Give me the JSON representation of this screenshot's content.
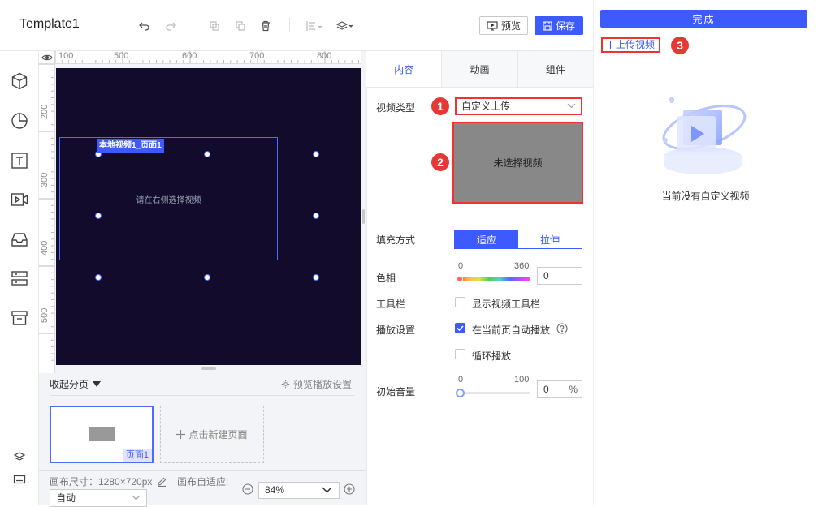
{
  "header": {
    "title": "Template1",
    "preview_label": "预览",
    "save_label": "保存"
  },
  "canvas": {
    "ruler_top": [
      "100",
      "500",
      "600",
      "700",
      "800"
    ],
    "ruler_left": [
      "200",
      "300",
      "400",
      "500"
    ],
    "video_tag": "本地视频1_页面1",
    "video_hint": "请在右侧选择视频"
  },
  "pages": {
    "collapse_label": "收起分页",
    "preview_settings_label": "预览播放设置",
    "page_label": "页面1",
    "new_page_label": "点击新建页面",
    "canvas_size_label": "画布尺寸：1280×720px",
    "canvas_fit_label": "画布自适应:",
    "fit_value": "自动",
    "zoom_value": "84%"
  },
  "panel": {
    "tabs": [
      "内容",
      "动画",
      "组件"
    ],
    "video_type_label": "视频类型",
    "video_type_value": "自定义上传",
    "picker_text": "未选择视频",
    "fill_label": "填充方式",
    "fill_fit": "适应",
    "fill_stretch": "拉伸",
    "hue_label": "色相",
    "hue_min": "0",
    "hue_max": "360",
    "hue_value": "0",
    "toolbar_label": "工具栏",
    "toolbar_option": "显示视频工具栏",
    "play_label": "播放设置",
    "autoplay_option": "在当前页自动播放",
    "loop_option": "循环播放",
    "volume_label": "初始音量",
    "volume_min": "0",
    "volume_max": "100",
    "volume_value": "0",
    "volume_unit": "%"
  },
  "callouts": [
    "1",
    "2",
    "3"
  ],
  "upload": {
    "done_label": "完成",
    "upload_link": "上传视频",
    "empty_text": "当前没有自定义视频"
  },
  "colors": {
    "accent": "#3d5afe",
    "stage_bg": "#120b2b",
    "highlight": "#e33333"
  }
}
